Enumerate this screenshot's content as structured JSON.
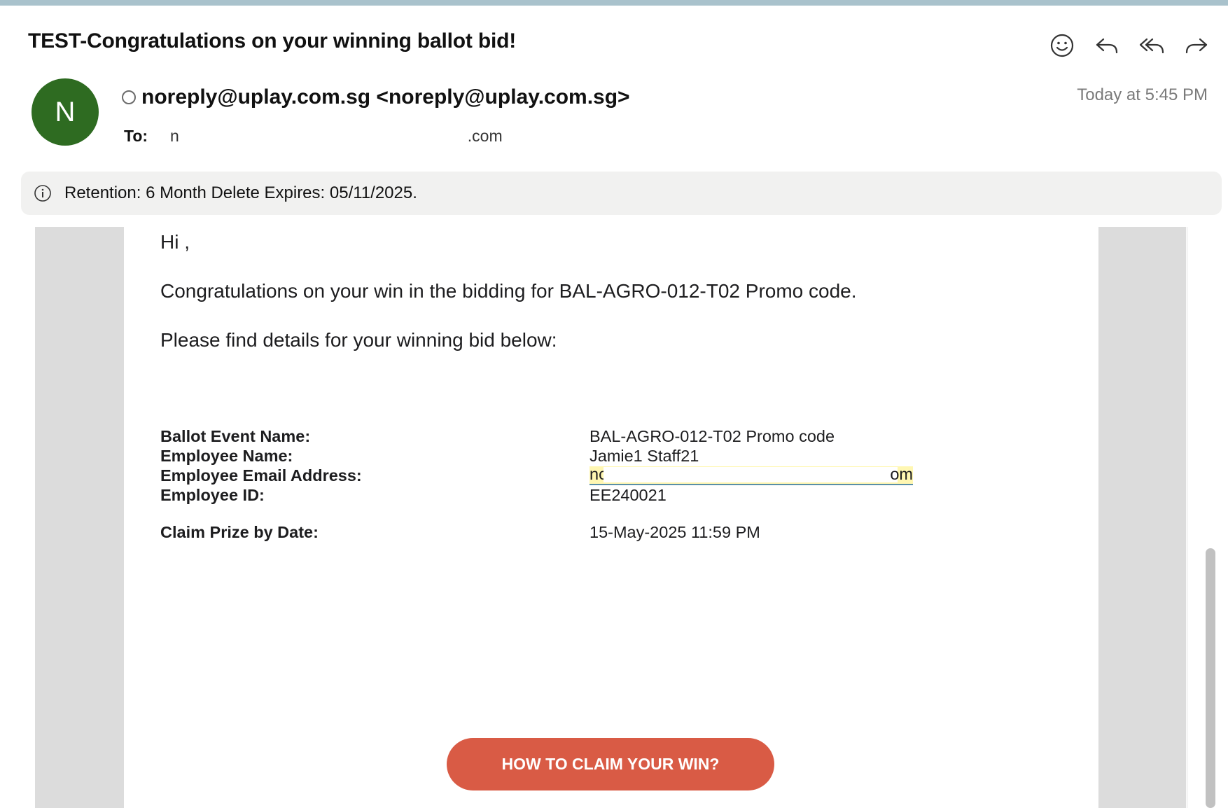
{
  "subject": "TEST-Congratulations on your winning ballot bid!",
  "actions": [
    {
      "name": "emoji-reaction-icon",
      "label": "React"
    },
    {
      "name": "reply-icon",
      "label": "Reply"
    },
    {
      "name": "reply-all-icon",
      "label": "Reply All"
    },
    {
      "name": "forward-icon",
      "label": "Forward"
    }
  ],
  "sender": {
    "avatar_initial": "N",
    "avatar_color": "#2e6b21",
    "display": "noreply@uplay.com.sg <noreply@uplay.com.sg>",
    "date": "Today at 5:45 PM"
  },
  "to": {
    "label": "To:",
    "visible_prefix": "n",
    "visible_suffix": ".com"
  },
  "retention": {
    "icon": "info-icon",
    "text": "Retention: 6 Month Delete Expires: 05/11/2025."
  },
  "body": {
    "greeting": "Hi ,",
    "line1": "Congratulations on your win in the bidding for BAL-AGRO-012-T02 Promo code.",
    "line2": "Please find details for your winning bid below:",
    "details": {
      "ballot_event_label": "Ballot Event Name:",
      "ballot_event_value": "BAL-AGRO-012-T02 Promo code",
      "employee_name_label": "Employee Name:",
      "employee_name_value": "Jamie1 Staff21",
      "employee_email_label": "Employee Email Address:",
      "employee_email_prefix": "nc",
      "employee_email_suffix": "om",
      "employee_id_label": "Employee ID:",
      "employee_id_value": "EE240021",
      "claim_date_label": "Claim Prize by Date:",
      "claim_date_value": "15-May-2025 11:59 PM"
    },
    "cta_label": "HOW TO CLAIM YOUR WIN?",
    "cta_color": "#d95b45"
  }
}
